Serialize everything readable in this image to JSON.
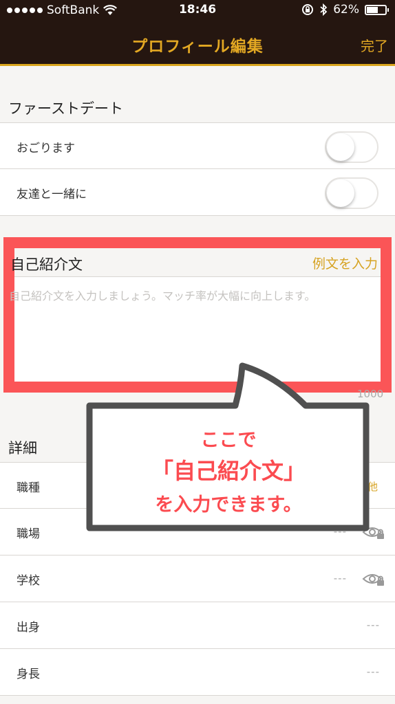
{
  "status_bar": {
    "carrier": "SoftBank",
    "time": "18:46",
    "battery": "62%",
    "battery_level": 0.62
  },
  "nav": {
    "title": "プロフィール編集",
    "done": "完了"
  },
  "first_date": {
    "header": "ファーストデート",
    "rows": [
      {
        "label": "おごります",
        "on": false
      },
      {
        "label": "友達と一緒に",
        "on": false
      }
    ]
  },
  "intro": {
    "title": "自己紹介文",
    "example_button": "例文を入力",
    "placeholder": "自己紹介文を入力しましょう。マッチ率が大幅に向上します。",
    "counter": "1000"
  },
  "details": {
    "header": "詳細",
    "rows": [
      {
        "label": "職種",
        "value": "他"
      },
      {
        "label": "職場",
        "value": "---"
      },
      {
        "label": "学校",
        "value": "---"
      },
      {
        "label": "出身",
        "value": "---"
      },
      {
        "label": "身長",
        "value": "---"
      }
    ]
  },
  "callout": {
    "line1": "ここで",
    "line2": "「自己紹介文」",
    "line3": "を入力できます。"
  },
  "colors": {
    "header_bg": "#251610",
    "accent_gold": "#e3a823",
    "highlight_red": "#fb5557",
    "callout_border": "#505050"
  }
}
